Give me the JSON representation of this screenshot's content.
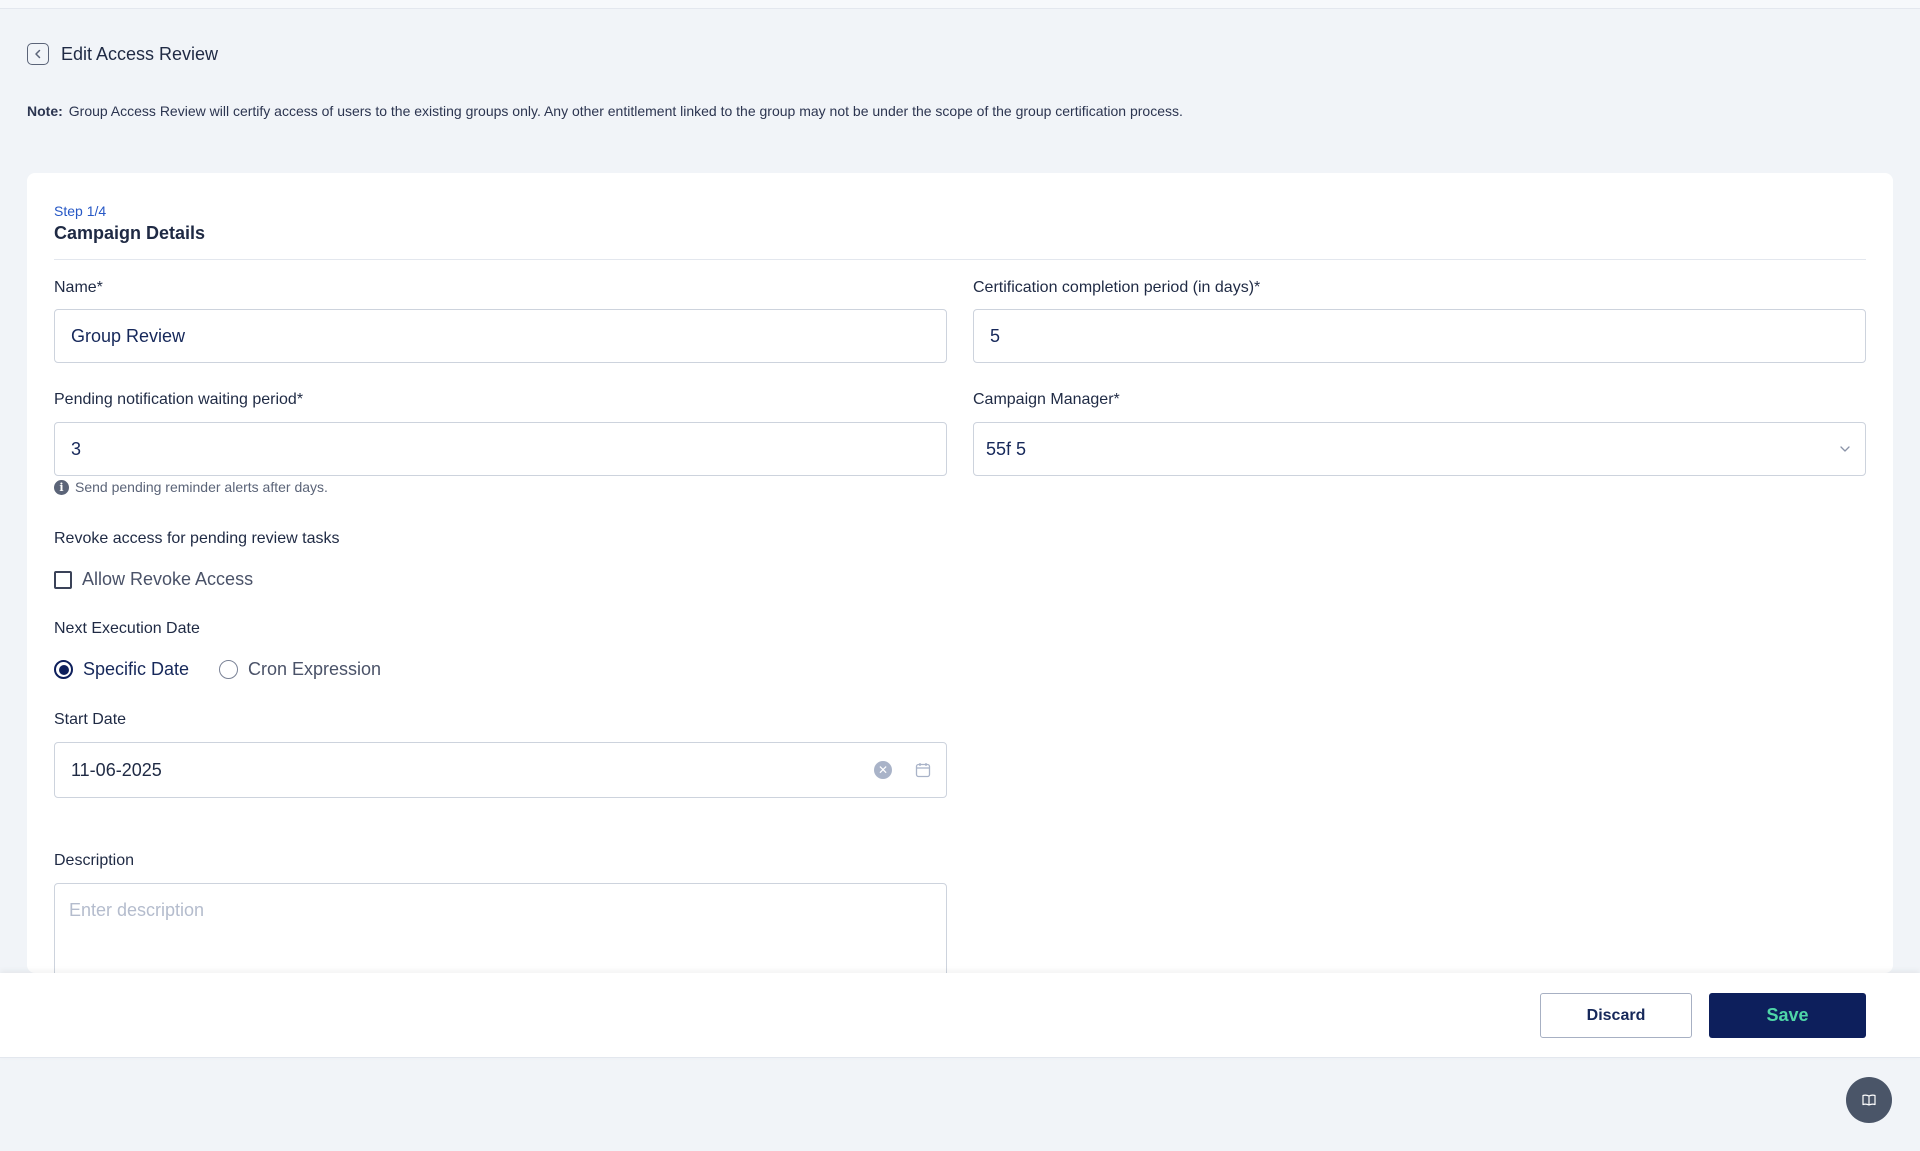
{
  "header": {
    "title": "Edit Access Review",
    "back_icon": "chevron-left-icon"
  },
  "note": {
    "label": "Note:",
    "text": "Group Access Review will certify access of users to the existing groups only. Any other entitlement linked to the group may not be under the scope of the group certification process."
  },
  "step": {
    "indicator": "Step 1/4",
    "title": "Campaign Details"
  },
  "form": {
    "name": {
      "label": "Name*",
      "value": "Group Review"
    },
    "certification_period": {
      "label": "Certification completion period (in days)*",
      "value": "5"
    },
    "pending_notification": {
      "label": "Pending notification waiting period*",
      "value": "3",
      "hint": "Send pending reminder alerts after days."
    },
    "campaign_manager": {
      "label": "Campaign Manager*",
      "value": "55f 5"
    },
    "revoke": {
      "label": "Revoke access for pending review tasks",
      "checkbox_label": "Allow Revoke Access",
      "checked": false
    },
    "next_execution": {
      "label": "Next Execution Date",
      "options": [
        "Specific Date",
        "Cron Expression"
      ],
      "selected": "Specific Date"
    },
    "start_date": {
      "label": "Start Date",
      "value": "11-06-2025"
    },
    "description": {
      "label": "Description",
      "placeholder": "Enter description"
    }
  },
  "footer": {
    "discard_label": "Discard",
    "save_label": "Save"
  },
  "colors": {
    "accent": "#0d1f5c",
    "save_text": "#4fd6a8",
    "step_link": "#2657c5",
    "background": "#f1f4f8"
  }
}
